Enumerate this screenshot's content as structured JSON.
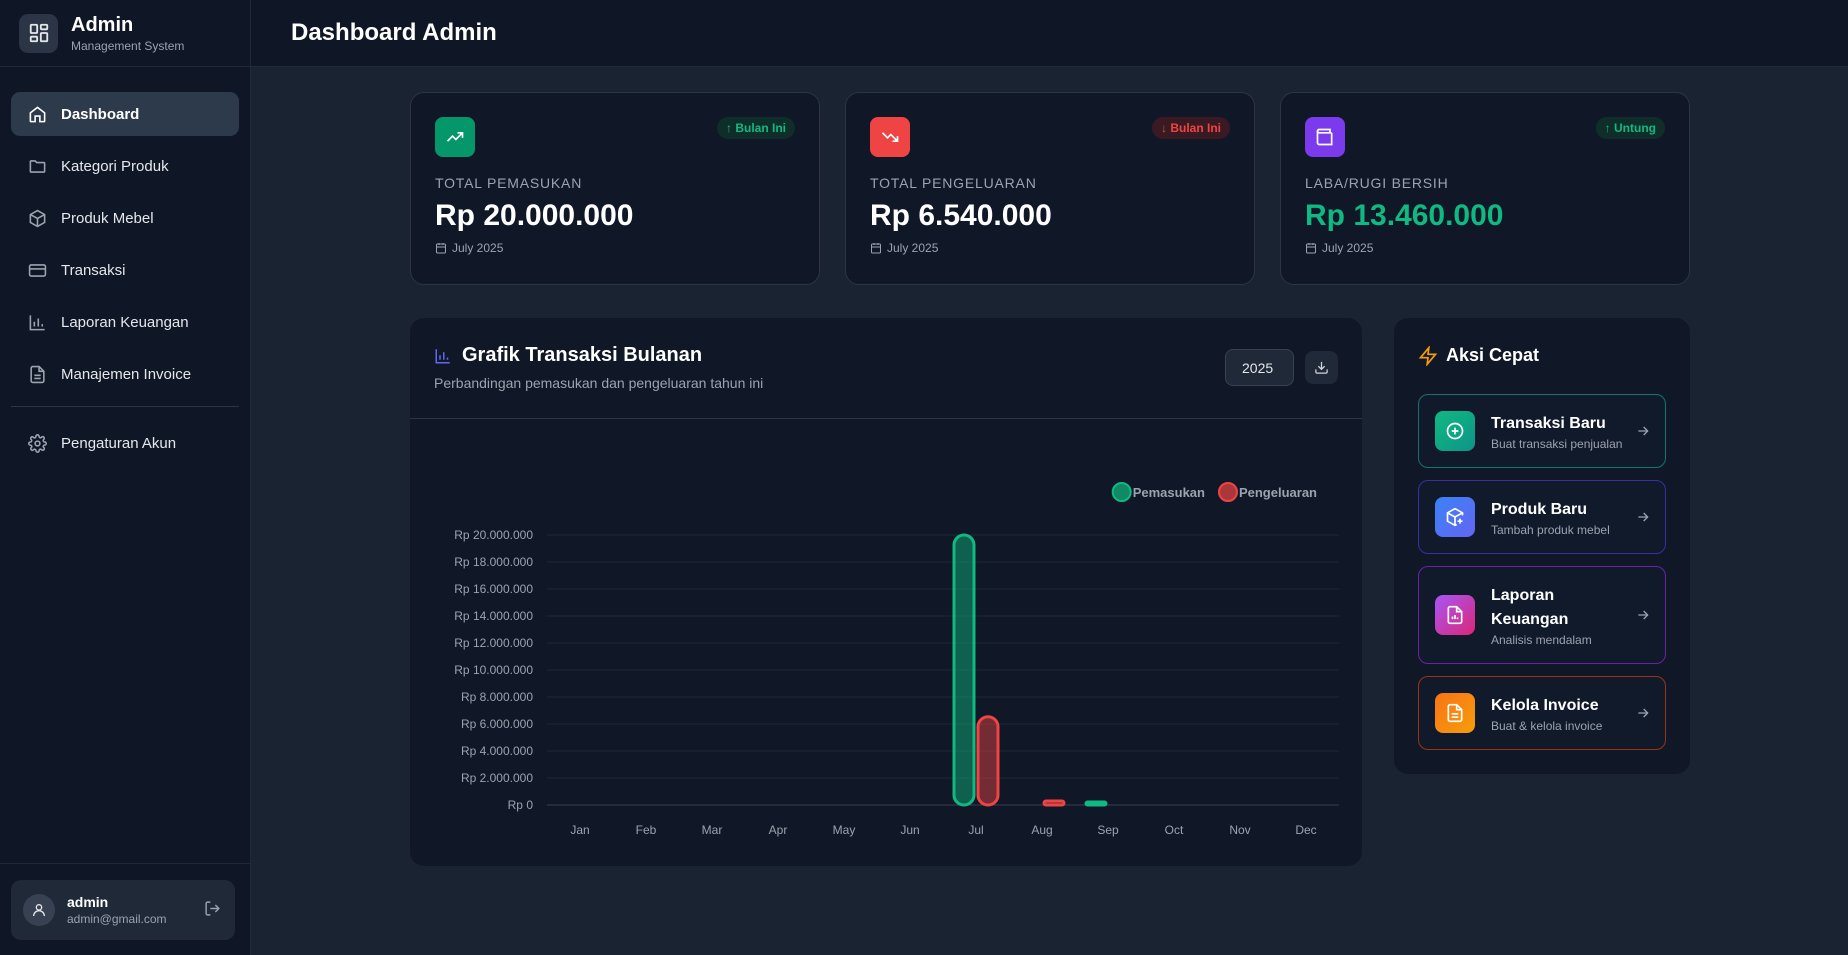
{
  "brand": {
    "title": "Admin",
    "subtitle": "Management System"
  },
  "page": {
    "title": "Dashboard Admin"
  },
  "sidebar": {
    "items": [
      {
        "label": "Dashboard",
        "icon": "home-icon",
        "active": true
      },
      {
        "label": "Kategori Produk",
        "icon": "folder-icon"
      },
      {
        "label": "Produk Mebel",
        "icon": "box-icon"
      },
      {
        "label": "Transaksi",
        "icon": "credit-card-icon"
      },
      {
        "label": "Laporan Keuangan",
        "icon": "bar-chart-icon"
      },
      {
        "label": "Manajemen Invoice",
        "icon": "file-text-icon"
      }
    ],
    "settings": {
      "label": "Pengaturan Akun",
      "icon": "gear-icon"
    }
  },
  "user": {
    "name": "admin",
    "email": "admin@gmail.com"
  },
  "stats": [
    {
      "label": "TOTAL PEMASUKAN",
      "value": "Rp 20.000.000",
      "date": "July 2025",
      "badge": "↑ Bulan Ini",
      "color": "#059669",
      "badge_color": "#10b981",
      "value_color": "#ffffff"
    },
    {
      "label": "TOTAL PENGELUARAN",
      "value": "Rp 6.540.000",
      "date": "July 2025",
      "badge": "↓ Bulan Ini",
      "color": "#ef4444",
      "badge_color": "#ef4444",
      "value_color": "#ffffff"
    },
    {
      "label": "LABA/RUGI BERSIH",
      "value": "Rp 13.460.000",
      "date": "July 2025",
      "badge": "↑ Untung",
      "color": "#7c3aed",
      "badge_color": "#10b981",
      "value_color": "#10b981"
    }
  ],
  "chart_panel": {
    "title": "Grafik Transaksi Bulanan",
    "subtitle": "Perbandingan pemasukan dan pengeluaran tahun ini",
    "year": "2025"
  },
  "chart_data": {
    "type": "bar",
    "categories": [
      "Jan",
      "Feb",
      "Mar",
      "Apr",
      "May",
      "Jun",
      "Jul",
      "Aug",
      "Sep",
      "Oct",
      "Nov",
      "Dec"
    ],
    "series": [
      {
        "name": "Pemasukan",
        "color": "#10b981",
        "values": [
          0,
          0,
          0,
          0,
          0,
          0,
          20000000,
          0,
          100000,
          0,
          0,
          0
        ]
      },
      {
        "name": "Pengeluaran",
        "color": "#ef4444",
        "values": [
          0,
          0,
          0,
          0,
          0,
          0,
          6540000,
          300000,
          0,
          0,
          0,
          0
        ]
      }
    ],
    "ylim": [
      0,
      20000000
    ],
    "yticks": [
      {
        "value": 20000000,
        "label": "Rp 20.000.000"
      },
      {
        "value": 18000000,
        "label": "Rp 18.000.000"
      },
      {
        "value": 16000000,
        "label": "Rp 16.000.000"
      },
      {
        "value": 14000000,
        "label": "Rp 14.000.000"
      },
      {
        "value": 12000000,
        "label": "Rp 12.000.000"
      },
      {
        "value": 10000000,
        "label": "Rp 10.000.000"
      },
      {
        "value": 8000000,
        "label": "Rp 8.000.000"
      },
      {
        "value": 6000000,
        "label": "Rp 6.000.000"
      },
      {
        "value": 4000000,
        "label": "Rp 4.000.000"
      },
      {
        "value": 2000000,
        "label": "Rp 2.000.000"
      },
      {
        "value": 0,
        "label": "Rp 0"
      }
    ],
    "legend": "top-right",
    "grid": true
  },
  "quick_actions": {
    "title": "Aksi Cepat",
    "items": [
      {
        "title": "Transaksi Baru",
        "subtitle": "Buat transaksi penjualan",
        "border": "#0f766e",
        "grad_from": "#10b981",
        "grad_to": "#0d9488"
      },
      {
        "title": "Produk Baru",
        "subtitle": "Tambah produk mebel",
        "border": "#3730a3",
        "grad_from": "#3b82f6",
        "grad_to": "#6366f1"
      },
      {
        "title": "Laporan Keuangan",
        "subtitle": "Analisis mendalam",
        "border": "#6b21a8",
        "grad_from": "#a855f7",
        "grad_to": "#db2777"
      },
      {
        "title": "Kelola Invoice",
        "subtitle": "Buat & kelola invoice",
        "border": "#9a3412",
        "grad_from": "#f97316",
        "grad_to": "#f59e0b"
      }
    ]
  }
}
